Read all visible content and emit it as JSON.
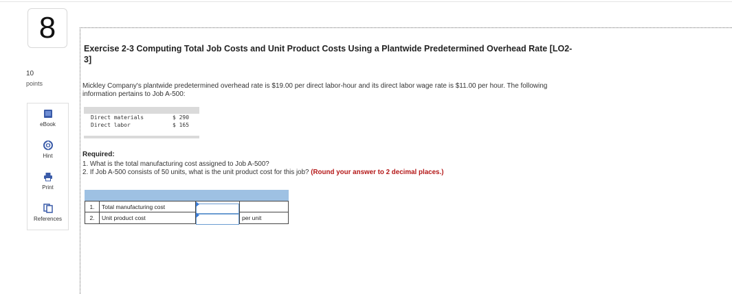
{
  "question": {
    "number": "8",
    "points_value": "10",
    "points_label": "points"
  },
  "tools": [
    {
      "label": "eBook",
      "icon": "book-icon"
    },
    {
      "label": "Hint",
      "icon": "hint-icon"
    },
    {
      "label": "Print",
      "icon": "print-icon"
    },
    {
      "label": "References",
      "icon": "references-icon"
    }
  ],
  "exercise": {
    "title": "Exercise 2-3 Computing Total Job Costs and Unit Product Costs Using a Plantwide Predetermined Overhead Rate [LO2-3]",
    "intro": "Mickley Company's plantwide predetermined overhead rate is $19.00 per direct labor-hour and its direct labor wage rate is $11.00 per hour. The following information pertains to Job A-500:",
    "data": [
      {
        "label": "Direct materials",
        "value": "$ 290"
      },
      {
        "label": "Direct labor",
        "value": "$ 165"
      }
    ],
    "required_heading": "Required:",
    "required_1": "1. What is the total manufacturing cost assigned to Job A-500?",
    "required_2_text": "2. If Job A-500 consists of 50 units, what is the unit product cost for this job?",
    "required_2_emphasis": "(Round your answer to 2 decimal places.)"
  },
  "answers": [
    {
      "num": "1.",
      "label": "Total manufacturing cost",
      "value": "",
      "unit": ""
    },
    {
      "num": "2.",
      "label": "Unit product cost",
      "value": "",
      "unit": "per unit"
    }
  ],
  "colors": {
    "accent_blue": "#9ec1e3",
    "emphasis_red": "#b41818",
    "icon_blue": "#3a5ba8"
  }
}
